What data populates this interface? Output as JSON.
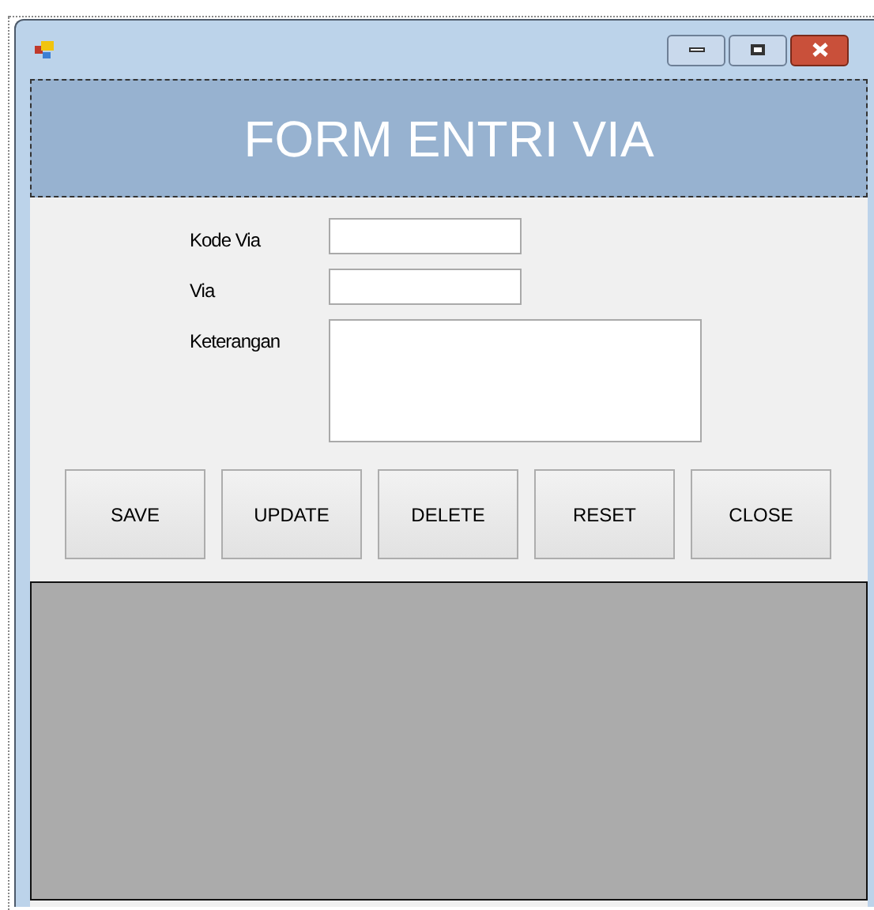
{
  "header": {
    "title": "FORM ENTRI VIA"
  },
  "fields": [
    {
      "label": "Kode Via",
      "kind": "text"
    },
    {
      "label": "Via",
      "kind": "text"
    },
    {
      "label": "Keterangan",
      "kind": "multiline"
    }
  ],
  "buttons": [
    "SAVE",
    "UPDATE",
    "DELETE",
    "RESET",
    "CLOSE"
  ]
}
